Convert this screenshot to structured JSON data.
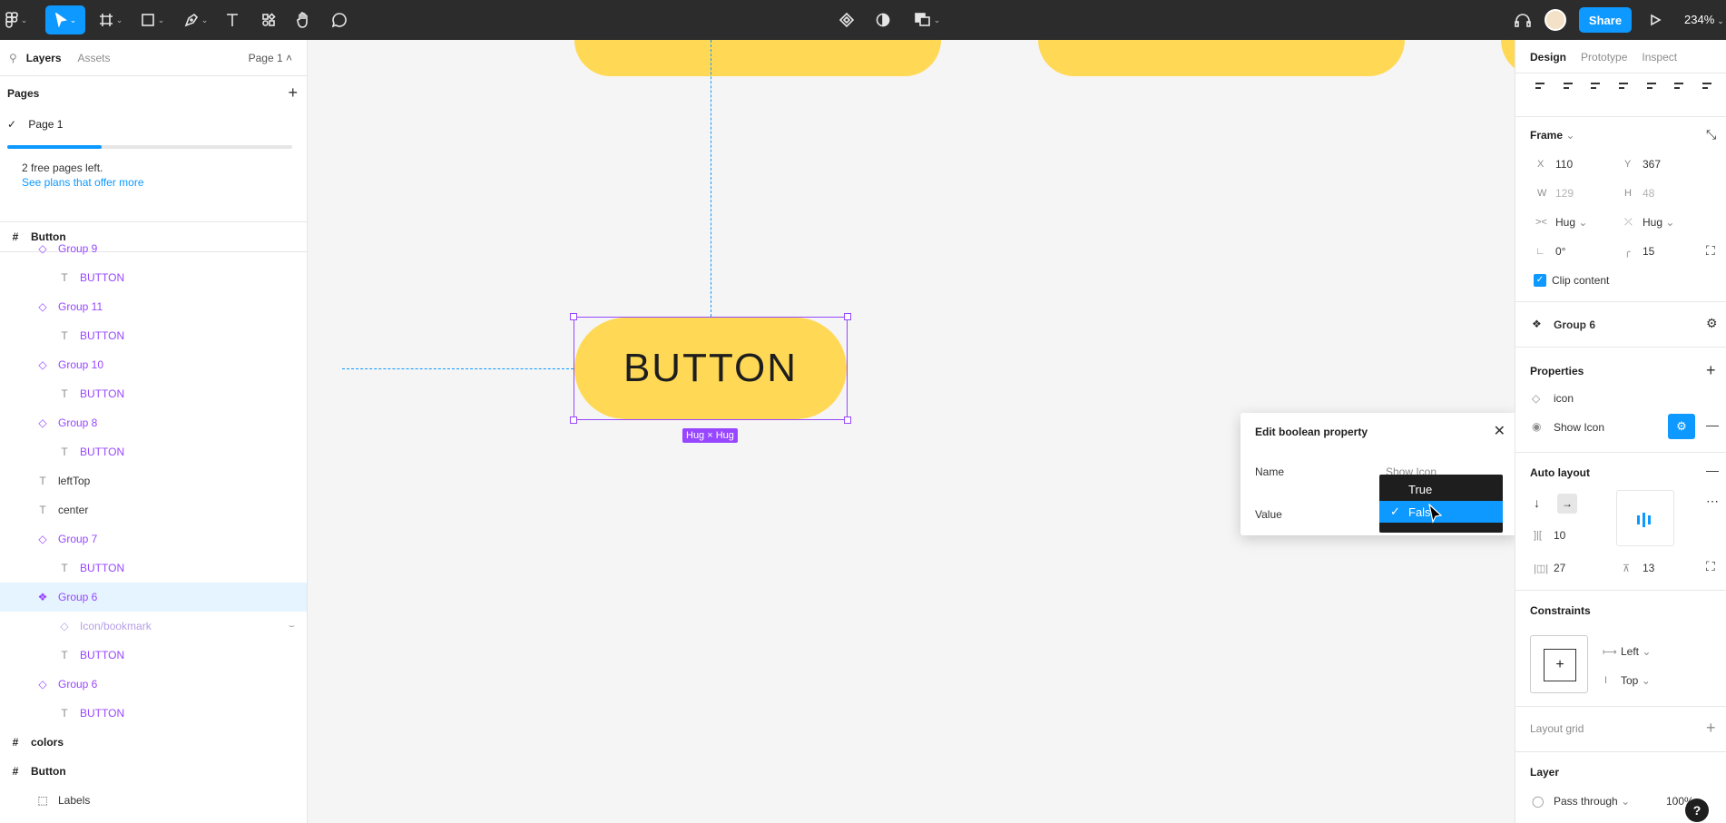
{
  "toolbar": {
    "tools": [
      "figma-menu",
      "move",
      "frame",
      "shape",
      "pen",
      "text",
      "resources",
      "hand",
      "comment"
    ],
    "share_label": "Share",
    "zoom": "234%"
  },
  "left_panel": {
    "tabs": [
      "Layers",
      "Assets"
    ],
    "page_selector": "Page 1",
    "pages_heading": "Pages",
    "pages": [
      {
        "name": "Page 1",
        "current": true
      }
    ],
    "free_pages_progress": 0.33,
    "free_pages_text": "2 free pages left.",
    "plans_link": "See plans that offer more",
    "root_frame": "Button",
    "layers": [
      {
        "name": "Group 9",
        "type": "comp"
      },
      {
        "name": "BUTTON",
        "type": "text"
      },
      {
        "name": "Group 11",
        "type": "comp"
      },
      {
        "name": "BUTTON",
        "type": "text"
      },
      {
        "name": "Group 10",
        "type": "comp"
      },
      {
        "name": "BUTTON",
        "type": "text"
      },
      {
        "name": "Group 8",
        "type": "comp"
      },
      {
        "name": "BUTTON",
        "type": "text"
      },
      {
        "name": "leftTop",
        "type": "plain-text"
      },
      {
        "name": "center",
        "type": "plain-text"
      },
      {
        "name": "Group 7",
        "type": "comp"
      },
      {
        "name": "BUTTON",
        "type": "text"
      },
      {
        "name": "Group 6",
        "type": "comp-selected"
      },
      {
        "name": "Icon/bookmark",
        "type": "hidden"
      },
      {
        "name": "BUTTON",
        "type": "text"
      },
      {
        "name": "Group 6",
        "type": "comp"
      },
      {
        "name": "BUTTON",
        "type": "text"
      },
      {
        "name": "colors",
        "type": "frame"
      },
      {
        "name": "Button",
        "type": "frame"
      },
      {
        "name": "Labels",
        "type": "section"
      }
    ]
  },
  "canvas": {
    "button_text": "BUTTON",
    "badge": "Hug × Hug",
    "popup": {
      "title": "Edit boolean property",
      "name_label": "Name",
      "name_value": "Show Icon",
      "value_label": "Value"
    },
    "dropdown": {
      "options": [
        "True",
        "False"
      ],
      "selected": "False"
    }
  },
  "right_panel": {
    "tabs": [
      "Design",
      "Prototype",
      "Inspect"
    ],
    "frame_label": "Frame",
    "x_label": "X",
    "x": "110",
    "y_label": "Y",
    "y": "367",
    "w_label": "W",
    "w": "129",
    "h_label": "H",
    "h": "48",
    "hug_h": "Hug",
    "hug_v": "Hug",
    "rotation": "0°",
    "radius": "15",
    "clip_content": "Clip content",
    "component": "Group 6",
    "properties_label": "Properties",
    "prop_icon": "icon",
    "prop_show_icon": "Show Icon",
    "auto_layout_label": "Auto layout",
    "spacing": "10",
    "padding_h": "27",
    "padding_v": "13",
    "constraints_label": "Constraints",
    "constraint_h": "Left",
    "constraint_v": "Top",
    "layout_grid_label": "Layout grid",
    "layer_label": "Layer",
    "blend": "Pass through",
    "opacity": "100%"
  },
  "help": "?"
}
